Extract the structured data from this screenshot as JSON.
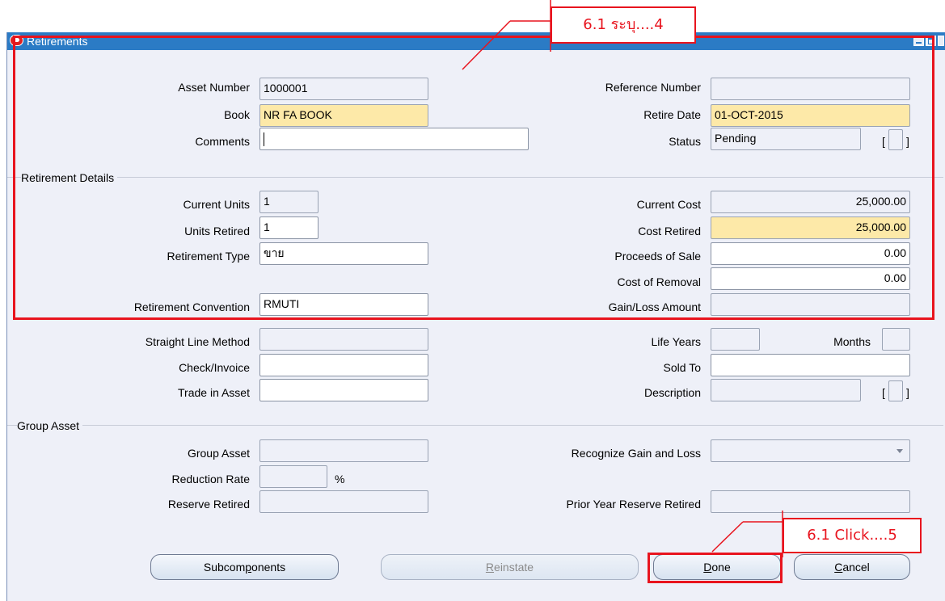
{
  "window": {
    "title": "Retirements"
  },
  "fields": {
    "asset_number": {
      "label": "Asset Number",
      "value": "1000001"
    },
    "book": {
      "label": "Book",
      "value": "NR FA BOOK"
    },
    "comments": {
      "label": "Comments",
      "value": ""
    },
    "reference_number": {
      "label": "Reference Number",
      "value": ""
    },
    "retire_date": {
      "label": "Retire Date",
      "value": "01-OCT-2015"
    },
    "status": {
      "label": "Status",
      "value": "Pending"
    }
  },
  "retirement_details": {
    "title": "Retirement Details",
    "current_units": {
      "label": "Current Units",
      "value": "1"
    },
    "units_retired": {
      "label": "Units Retired",
      "value": "1"
    },
    "retirement_type": {
      "label": "Retirement Type",
      "value": "ขาย"
    },
    "retirement_convention": {
      "label": "Retirement Convention",
      "value": "RMUTI"
    },
    "current_cost": {
      "label": "Current Cost",
      "value": "25,000.00"
    },
    "cost_retired": {
      "label": "Cost Retired",
      "value": "25,000.00"
    },
    "proceeds_of_sale": {
      "label": "Proceeds of Sale",
      "value": "0.00"
    },
    "cost_of_removal": {
      "label": "Cost of Removal",
      "value": "0.00"
    },
    "gain_loss_amount": {
      "label": "Gain/Loss Amount",
      "value": ""
    }
  },
  "other": {
    "straight_line_method": {
      "label": "Straight Line Method",
      "value": ""
    },
    "check_invoice": {
      "label": "Check/Invoice",
      "value": ""
    },
    "trade_in_asset": {
      "label": "Trade in Asset",
      "value": ""
    },
    "life_years": {
      "label": "Life Years",
      "value": ""
    },
    "months": {
      "label": "Months",
      "value": ""
    },
    "sold_to": {
      "label": "Sold To",
      "value": ""
    },
    "description": {
      "label": "Description",
      "value": ""
    }
  },
  "group_asset": {
    "title": "Group Asset",
    "group_asset": {
      "label": "Group Asset",
      "value": ""
    },
    "reduction_rate": {
      "label": "Reduction Rate",
      "value": "",
      "unit": "%"
    },
    "reserve_retired": {
      "label": "Reserve Retired",
      "value": ""
    },
    "recognize_gain_and_loss": {
      "label": "Recognize Gain and Loss",
      "value": ""
    },
    "prior_year_reserve_retired": {
      "label": "Prior Year Reserve Retired",
      "value": ""
    }
  },
  "buttons": {
    "subcomponents": "Subcomponents",
    "reinstate": "Reinstate",
    "done": "Done",
    "cancel": "Cancel"
  },
  "brackets": {
    "open": "[",
    "close": "]"
  },
  "annotations": {
    "callout_top": "6.1 ระบุ....4",
    "callout_bottom": "6.1 Click....5",
    "color": "#e8141e"
  }
}
